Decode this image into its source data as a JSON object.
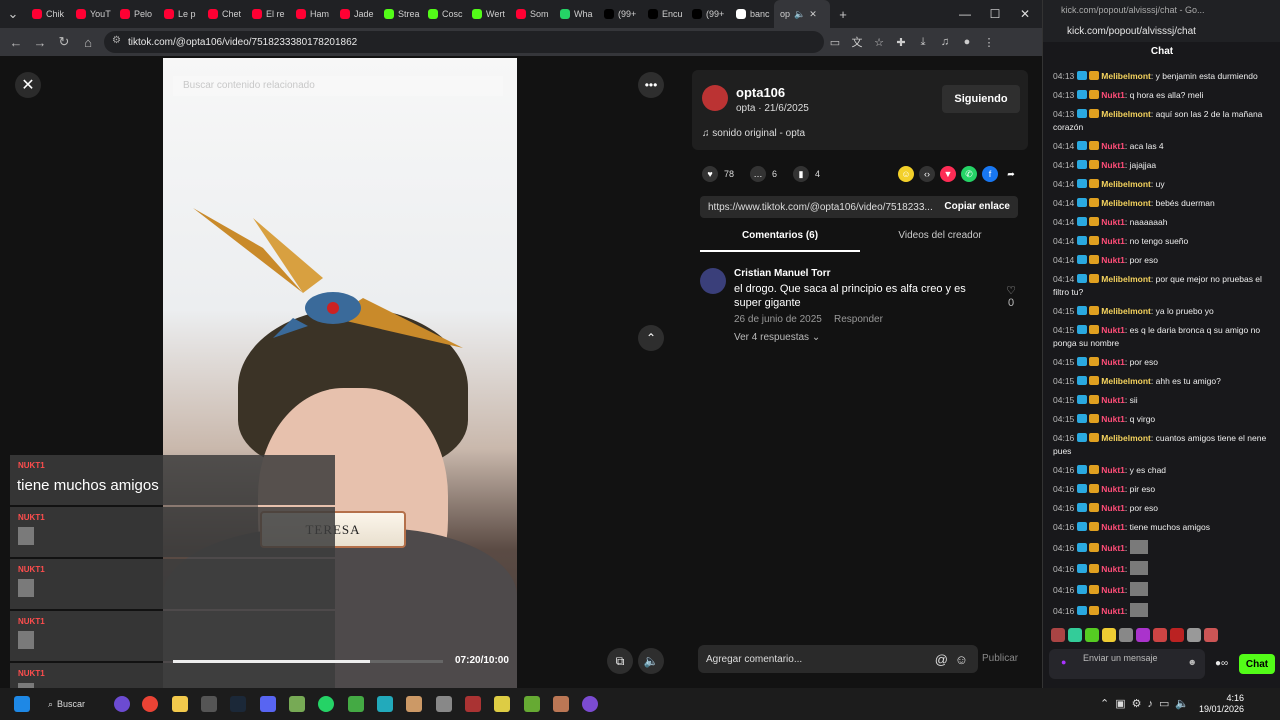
{
  "browser": {
    "tabs": [
      "Chik",
      "YouT",
      "Pelo",
      "Le p",
      "Chet",
      "El re",
      "Ham",
      "Jade",
      "Strea",
      "Cosc",
      "Wert",
      "Som",
      "Wha",
      "(99+",
      "Encu",
      "(99+",
      "banc"
    ],
    "active_tab": "op",
    "new_tab": "+",
    "url": "tiktok.com/@opta106/video/7518233380178201862"
  },
  "video": {
    "search_placeholder": "Buscar contenido relacionado",
    "time": "07:20/10:00",
    "progress": 0.73,
    "overlay_messages": [
      {
        "name": "NUKT1",
        "text": "tiene muchos amigos"
      },
      {
        "name": "NUKT1",
        "text": ""
      },
      {
        "name": "NUKT1",
        "text": ""
      },
      {
        "name": "NUKT1",
        "text": ""
      },
      {
        "name": "NUKT1",
        "text": ""
      }
    ],
    "filter_label": "TERESA"
  },
  "post": {
    "author": "opta106",
    "meta": "opta · 21/6/2025",
    "follow_label": "Siguiendo",
    "sound": "sonido original - opta",
    "likes": "78",
    "comments": "6",
    "saves": "4",
    "link": "https://www.tiktok.com/@opta106/video/7518233...",
    "copy_label": "Copiar enlace",
    "tab_comments": "Comentarios (6)",
    "tab_creator": "Videos del creador",
    "comment": {
      "name": "Cristian Manuel Torr",
      "text": "el drogo. Que saca al principio es alfa creo y es super gigante",
      "date": "26 de junio de 2025",
      "reply": "Responder",
      "more": "Ver 4 respuestas",
      "likes": "0"
    },
    "input_placeholder": "Agregar comentario...",
    "publish": "Publicar"
  },
  "kick": {
    "window_title": "kick.com/popout/alvisssj/chat - Go...",
    "url": "kick.com/popout/alvisssj/chat",
    "header": "Chat",
    "messages": [
      {
        "t": "04:13",
        "u": "Melibelmont",
        "c": 1,
        "m": "y benjamin esta durmiendo"
      },
      {
        "t": "04:13",
        "u": "Nukt1",
        "c": 2,
        "m": "q hora es alla? meli"
      },
      {
        "t": "04:13",
        "u": "Melibelmont",
        "c": 1,
        "m": "aquí son las 2 de la mañana corazón"
      },
      {
        "t": "04:14",
        "u": "Nukt1",
        "c": 2,
        "m": "aca las 4"
      },
      {
        "t": "04:14",
        "u": "Nukt1",
        "c": 2,
        "m": "jajajjaa"
      },
      {
        "t": "04:14",
        "u": "Melibelmont",
        "c": 1,
        "m": "uy"
      },
      {
        "t": "04:14",
        "u": "Melibelmont",
        "c": 1,
        "m": "bebés duerman"
      },
      {
        "t": "04:14",
        "u": "Nukt1",
        "c": 2,
        "m": "naaaaaah"
      },
      {
        "t": "04:14",
        "u": "Nukt1",
        "c": 2,
        "m": "no tengo sueño"
      },
      {
        "t": "04:14",
        "u": "Nukt1",
        "c": 2,
        "m": "por eso"
      },
      {
        "t": "04:14",
        "u": "Melibelmont",
        "c": 1,
        "m": "por que mejor no pruebas el filtro tu?"
      },
      {
        "t": "04:15",
        "u": "Melibelmont",
        "c": 1,
        "m": "ya lo pruebo yo"
      },
      {
        "t": "04:15",
        "u": "Nukt1",
        "c": 2,
        "m": "es q le daria bronca q su amigo no ponga su nombre"
      },
      {
        "t": "04:15",
        "u": "Nukt1",
        "c": 2,
        "m": "por eso"
      },
      {
        "t": "04:15",
        "u": "Melibelmont",
        "c": 1,
        "m": "ahh es tu amigo?"
      },
      {
        "t": "04:15",
        "u": "Nukt1",
        "c": 2,
        "m": "sii"
      },
      {
        "t": "04:15",
        "u": "Nukt1",
        "c": 2,
        "m": "q virgo"
      },
      {
        "t": "04:16",
        "u": "Melibelmont",
        "c": 1,
        "m": "cuantos amigos tiene el nene pues"
      },
      {
        "t": "04:16",
        "u": "Nukt1",
        "c": 2,
        "m": "y es chad"
      },
      {
        "t": "04:16",
        "u": "Nukt1",
        "c": 2,
        "m": "pir eso"
      },
      {
        "t": "04:16",
        "u": "Nukt1",
        "c": 2,
        "m": "por eso"
      },
      {
        "t": "04:16",
        "u": "Nukt1",
        "c": 2,
        "m": "tiene muchos amigos"
      },
      {
        "t": "04:16",
        "u": "Nukt1",
        "c": 2,
        "m": "",
        "img": true
      },
      {
        "t": "04:16",
        "u": "Nukt1",
        "c": 2,
        "m": "",
        "img": true
      },
      {
        "t": "04:16",
        "u": "Nukt1",
        "c": 2,
        "m": "",
        "img": true
      },
      {
        "t": "04:16",
        "u": "Nukt1",
        "c": 2,
        "m": "",
        "img": true
      }
    ],
    "input_placeholder": "Enviar un mensaje",
    "chat_button": "Chat"
  },
  "taskbar": {
    "search": "Buscar",
    "time": "4:16",
    "date": "19/01/2026"
  }
}
